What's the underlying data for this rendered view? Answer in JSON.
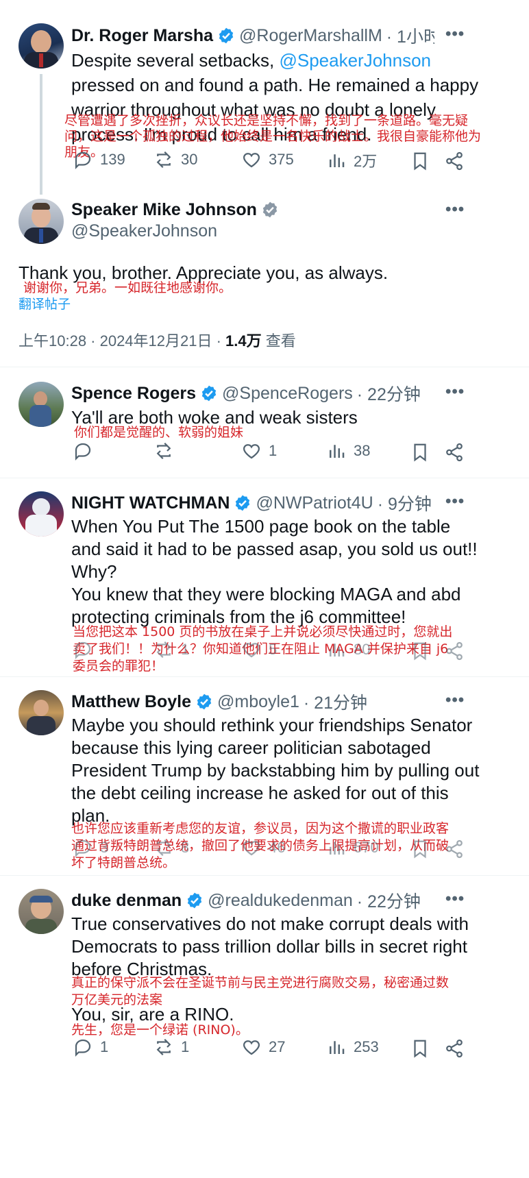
{
  "main_tweet": {
    "name": "Dr. Roger Marsha",
    "handle": "@RogerMarshallM",
    "time": "· 1小时",
    "text_prefix": "Despite several setbacks, ",
    "mention": "@SpeakerJohnson",
    "text_rest": "pressed on and found a path. He remained a happy warrior throughout what was no doubt a lonely process. I'm proud to call him a friend.",
    "translation": "尽管遭遇了多次挫折，众议长还是坚持不懈，找到了一条道路。毫无疑问，这是一个孤独的过程，他始终是一名快乐的战士。我很自豪能称他为朋友。",
    "stats": {
      "replies": "139",
      "reposts": "30",
      "likes": "375",
      "views": "2万"
    }
  },
  "focused_tweet": {
    "name": "Speaker Mike Johnson",
    "handle": "@SpeakerJohnson",
    "text": "Thank you, brother. Appreciate you, as always.",
    "translation": "谢谢你，兄弟。一如既往地感谢你。",
    "translate_link": "翻译帖子",
    "timestamp": "上午10:28 · 2024年12月21日 · ",
    "views_count": "1.4万",
    "views_label": " 查看"
  },
  "replies": [
    {
      "name": "Spence Rogers",
      "handle": "@SpenceRogers",
      "time": "· 22分钟",
      "text": "Ya'll are both woke and weak sisters",
      "translation": "你们都是觉醒的、软弱的姐妹",
      "stats": {
        "replies": "",
        "reposts": "",
        "likes": "1",
        "views": "38"
      }
    },
    {
      "name": "NIGHT WATCHMAN",
      "handle": "@NWPatriot4U",
      "time": "· 9分钟",
      "text": "When You Put The 1500 page book on the table and said it had to be passed asap, you sold us out!! Why?\nYou knew that they were blocking MAGA and abd protecting criminals from the j6 committee!",
      "translation": "当您把这本 1500 页的书放在桌子上并说必须尽快通过时，您就出卖了我们！！为什么？你知道他们正在阻止 MAGA 并保护来自 j6 委员会的罪犯！",
      "stats": {
        "replies": "",
        "reposts": "1",
        "likes": "5",
        "views": "80"
      }
    },
    {
      "name": "Matthew Boyle",
      "handle": "@mboyle1",
      "time": "· 21分钟",
      "text": "Maybe you should rethink your friendships Senator because this lying career politician sabotaged President Trump by backstabbing him by pulling out the debt ceiling increase he asked for out of this plan.",
      "translation": "也许您应该重新考虑您的友谊，参议员，因为这个撒谎的职业政客通过背叛特朗普总统，撤回了他要求的债务上限提高计划，从而破坏了特朗普总统。",
      "stats": {
        "replies": "3",
        "reposts": "8",
        "likes": "46",
        "views": "670"
      }
    },
    {
      "name": "duke denman",
      "handle": "@realdukedenman",
      "time": "· 22分钟",
      "text": "True conservatives do not make corrupt deals with Democrats to pass trillion dollar bills in secret right before Christmas.",
      "translation": "真正的保守派不会在圣诞节前与民主党进行腐败交易，秘密通过数万亿美元的法案",
      "text2": "You, sir, are a RINO.",
      "translation2": "先生，您是一个绿诺 (RINO)。",
      "stats": {
        "replies": "1",
        "reposts": "1",
        "likes": "27",
        "views": "253"
      }
    }
  ],
  "colors": {
    "accent": "#1d9bf0",
    "translation": "#d6262b",
    "secondary": "#536471"
  }
}
